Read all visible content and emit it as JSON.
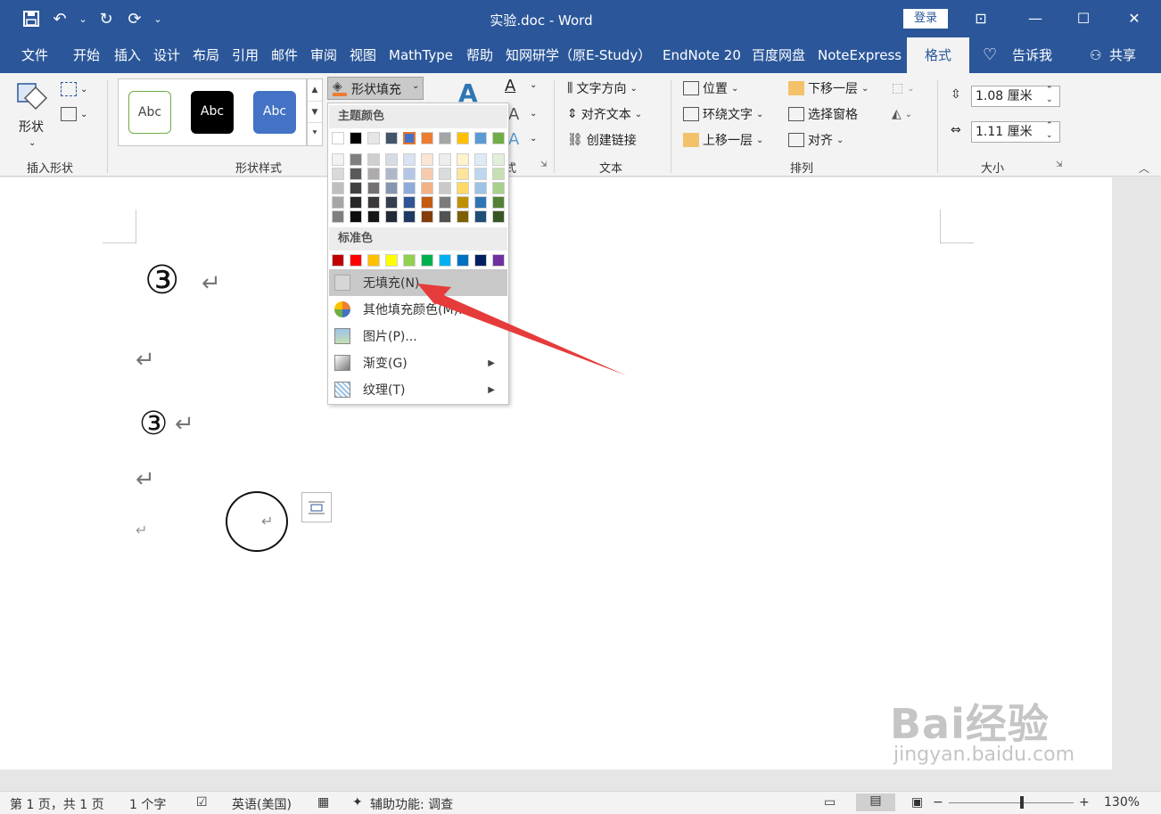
{
  "app": {
    "title": "实验.doc  -  Word",
    "login": "登录"
  },
  "tabs": [
    "文件",
    "开始",
    "插入",
    "设计",
    "布局",
    "引用",
    "邮件",
    "审阅",
    "视图",
    "MathType",
    "帮助",
    "知网研学（原E-Study）",
    "EndNote 20",
    "百度网盘",
    "NoteExpress",
    "格式"
  ],
  "tell_me": "告诉我",
  "share": "共享",
  "ribbon": {
    "shapes_label": "形状",
    "insert_shapes_group": "插入形状",
    "shape_styles_group": "形状样式",
    "abc": [
      "Abc",
      "Abc",
      "Abc"
    ],
    "shape_fill": "形状填充",
    "text_group_label": "文本",
    "partial_style_label": "式",
    "text_direction": "文字方向",
    "align_text": "对齐文本",
    "create_link": "创建链接",
    "arrange_group": "排列",
    "position": "位置",
    "wrap_text": "环绕文字",
    "bring_forward": "上移一层",
    "send_backward": "下移一层",
    "selection_pane": "选择窗格",
    "align": "对齐",
    "size_group": "大小",
    "height": "1.08 厘米",
    "width": "1.11 厘米"
  },
  "dropdown": {
    "theme_colors": "主题颜色",
    "standard_colors": "标准色",
    "no_fill": "无填充(N)",
    "more_colors": "其他填充颜色(M)...",
    "picture": "图片(P)...",
    "gradient": "渐变(G)",
    "texture": "纹理(T)",
    "theme_row": [
      "#ffffff",
      "#000000",
      "#e7e6e6",
      "#44546a",
      "#4472c4",
      "#ed7d31",
      "#a5a5a5",
      "#ffc000",
      "#5b9bd5",
      "#70ad47"
    ],
    "theme_shades": [
      [
        "#f2f2f2",
        "#d9d9d9",
        "#bfbfbf",
        "#a6a6a6",
        "#7f7f7f"
      ],
      [
        "#7f7f7f",
        "#595959",
        "#404040",
        "#262626",
        "#0d0d0d"
      ],
      [
        "#d0cece",
        "#aeabab",
        "#757171",
        "#3a3838",
        "#171616"
      ],
      [
        "#d6dce4",
        "#adb9ca",
        "#8496b0",
        "#333f4f",
        "#222a35"
      ],
      [
        "#d9e2f3",
        "#b4c6e7",
        "#8eaadb",
        "#2f5496",
        "#1f3864"
      ],
      [
        "#fbe5d5",
        "#f7cbac",
        "#f4b183",
        "#c55a11",
        "#843c0b"
      ],
      [
        "#ededed",
        "#dbdbdb",
        "#c9c9c9",
        "#7b7b7b",
        "#525252"
      ],
      [
        "#fff2cc",
        "#fee599",
        "#ffd965",
        "#bf9000",
        "#7f6000"
      ],
      [
        "#deebf6",
        "#bdd7ee",
        "#9dc3e6",
        "#2e75b5",
        "#1f4e79"
      ],
      [
        "#e2efd9",
        "#c5e0b3",
        "#a8d08d",
        "#538135",
        "#375623"
      ]
    ],
    "standard_row": [
      "#c00000",
      "#ff0000",
      "#ffc000",
      "#ffff00",
      "#92d050",
      "#00b050",
      "#00b0f0",
      "#0070c0",
      "#002060",
      "#7030a0"
    ]
  },
  "document": {
    "circled_3": "③",
    "para": "↵"
  },
  "status": {
    "page": "第 1 页，共 1 页",
    "words": "1 个字",
    "language": "英语(美国)",
    "accessibility": "辅助功能: 调查",
    "zoom": "130%"
  },
  "watermark": {
    "brand": "Bai经验",
    "url": "jingyan.baidu.com"
  }
}
